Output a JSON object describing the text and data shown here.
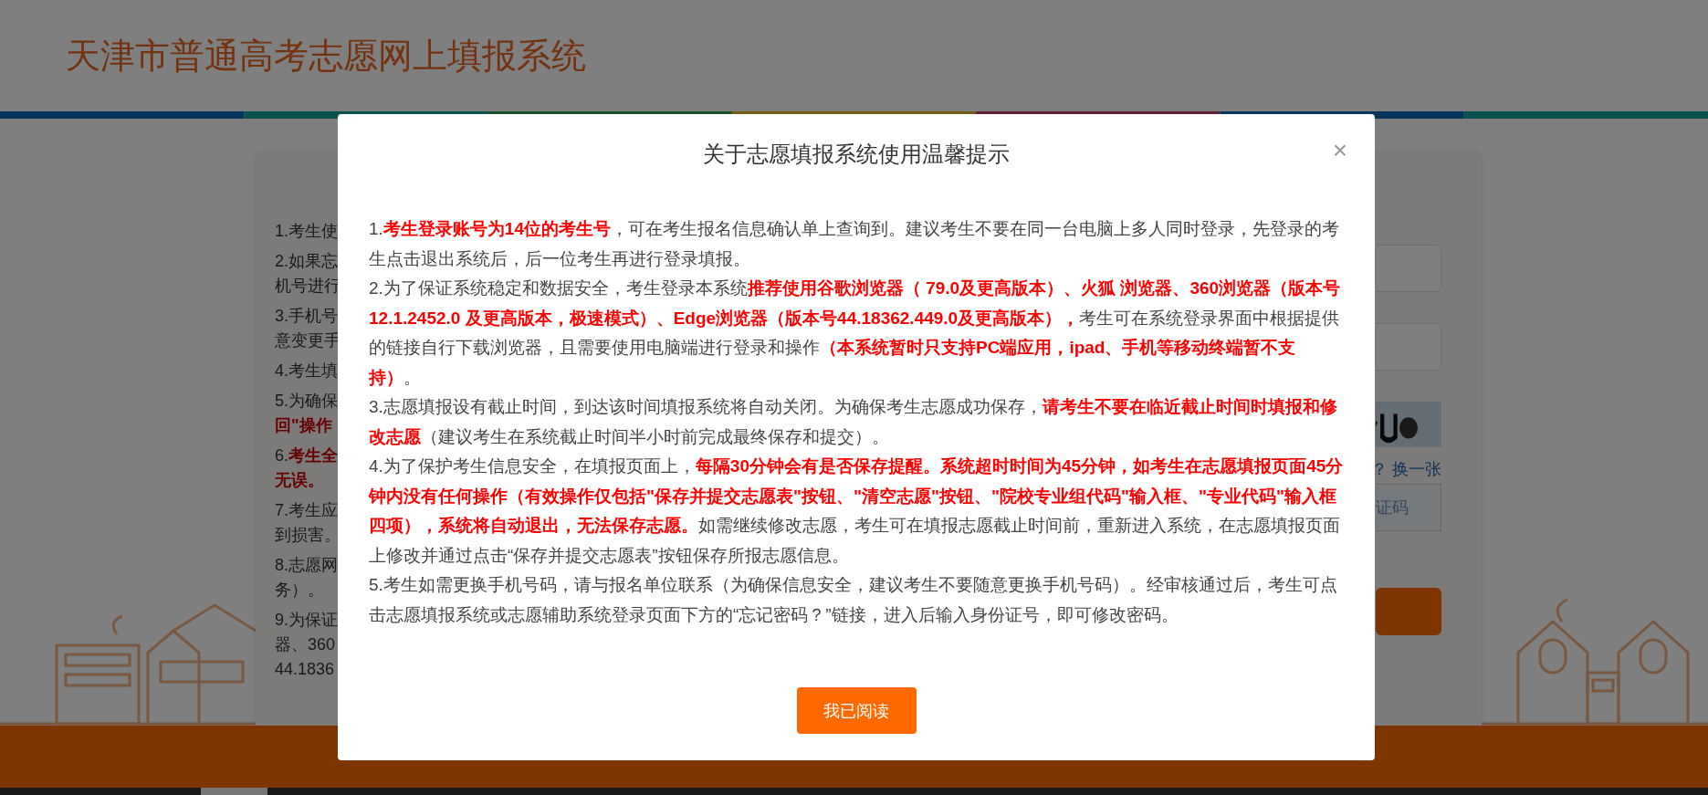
{
  "header": {
    "title": "天津市普通高考志愿网上填报系统"
  },
  "notice_panel": {
    "items": [
      [
        "1.考生使"
      ],
      [
        "2.如果忘",
        "机号进行"
      ],
      [
        "3.手机号",
        "意变更手"
      ],
      [
        "4.考生填"
      ],
      [
        "5.为确保",
        "**回\"操作**"
      ],
      [
        "6.**考生全**",
        "**无误。**"
      ],
      [
        "7.考生应",
        "到损害。"
      ],
      [
        "8.志愿网",
        "务）。"
      ],
      [
        "9.为保证",
        "器、360",
        "44.1836"
      ]
    ]
  },
  "login_panel": {
    "refresh_link": "？ 换一张",
    "code_field": {
      "placeholder": "证码"
    }
  },
  "dialog": {
    "title": "关于志愿填报系统使用温馨提示",
    "close": "×",
    "paragraphs": [
      "1.**考生登录账号为14位的考生号**，可在考生报名信息确认单上查询到。建议考生不要在同一台电脑上多人同时登录，先登录的考生点击退出系统后，后一位考生再进行登录填报。",
      "2.为了保证系统稳定和数据安全，考生登录本系统**推荐使用谷歌浏览器（ 79.0及更高版本）、火狐 浏览器、360浏览器（版本号12.1.2452.0 及更高版本，极速模式）、Edge浏览器（版本号44.18362.449.0及更高版本），**考生可在系统登录界面中根据提供的链接自行下载浏览器，且需要使用电脑端进行登录和操作**（本系统暂时只支持PC端应用，ipad、手机等移动终端暂不支持）**。",
      "3.志愿填报设有截止时间，到达该时间填报系统将自动关闭。为确保考生志愿成功保存，**请考生不要在临近截止时间时填报和修改志愿**（建议考生在系统截止时间半小时前完成最终保存和提交）。",
      "4.为了保护考生信息安全，在填报页面上，**每隔30分钟会有是否保存提醒。系统超时时间为45分钟，如考生在志愿填报页面45分钟内没有任何操作（有效操作仅包括\"保存并提交志愿表\"按钮、\"清空志愿\"按钮、\"院校专业组代码\"输入框、\"专业代码\"输入框四项），系统将自动退出，无法保存志愿。**如需继续修改志愿，考生可在填报志愿截止时间前，重新进入系统，在志愿填报页面上修改并通过点击“保存并提交志愿表”按钮保存所报志愿信息。",
      "5.考生如需更换手机号码，请与报名单位联系（为确保信息安全，建议考生不要随意更换手机号码）。经审核通过后，考生可点击志愿填报系统或志愿辅助系统登录页面下方的“忘记密码？”链接，进入后输入身份证号，即可修改密码。"
    ],
    "button": "我已阅读"
  }
}
